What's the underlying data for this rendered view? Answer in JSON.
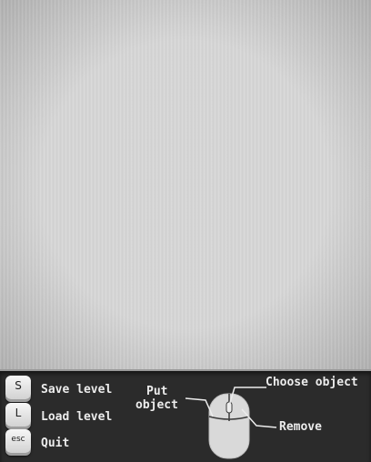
{
  "help": {
    "keys": [
      {
        "key": "S",
        "label": "Save level"
      },
      {
        "key": "L",
        "label": "Load level"
      },
      {
        "key": "esc",
        "label": "Quit"
      }
    ],
    "mouse": {
      "icon": "mouse-icon",
      "left_label_line1": "Put",
      "left_label_line2": "object",
      "middle_label": "Choose object",
      "right_label": "Remove"
    }
  },
  "colors": {
    "canvas": "#d6d6d6",
    "help_bar": "#2b2b2b",
    "label_text": "#ececec"
  }
}
